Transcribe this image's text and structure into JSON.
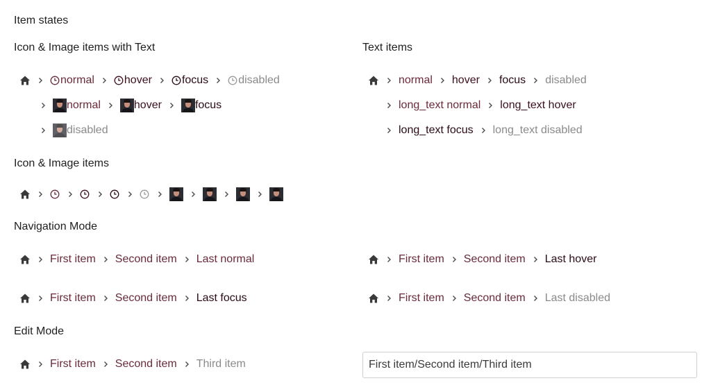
{
  "headings": {
    "item_states": "Item states",
    "icon_image_text": "Icon & Image items with Text",
    "text_items": "Text items",
    "icon_image": "Icon & Image items",
    "navigation_mode": "Navigation Mode",
    "edit_mode": "Edit Mode"
  },
  "icon_text": {
    "row1": [
      "normal",
      "hover",
      "focus",
      "disabled"
    ],
    "row2": [
      "normal",
      "hover",
      "focus"
    ],
    "row3": [
      "disabled"
    ]
  },
  "text_items": {
    "row1": [
      "normal",
      "hover",
      "focus",
      "disabled"
    ],
    "row2": [
      "long_text normal",
      "long_text hover"
    ],
    "row3": [
      "long_text focus",
      "long_text disabled"
    ]
  },
  "navigation": {
    "first": "First item",
    "second": "Second item",
    "last_normal": "Last normal",
    "last_hover": "Last hover",
    "last_focus": "Last focus",
    "last_disabled": "Last disabled"
  },
  "edit": {
    "first": "First item",
    "second": "Second item",
    "third": "Third item",
    "input_value": "First item/Second item/Third item"
  },
  "colors": {
    "link_normal": "#6b2a3a",
    "link_hover": "#3d0f1c",
    "link_focus": "#2b0a14",
    "disabled": "#8a8a8a"
  },
  "icons": [
    "home-icon",
    "chevron-right-icon",
    "clock-icon",
    "avatar-image"
  ]
}
